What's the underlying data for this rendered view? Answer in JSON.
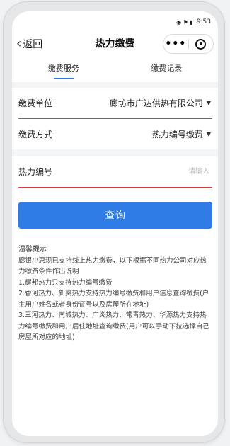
{
  "statusbar": {
    "icons": "◉ ⚑ ▮",
    "time": "9:53"
  },
  "navbar": {
    "back_label": "返回",
    "title": "热力缴费",
    "more_label": "•••"
  },
  "tabs": [
    {
      "label": "缴费服务",
      "active": true
    },
    {
      "label": "缴费记录",
      "active": false
    }
  ],
  "form": {
    "unit_label": "缴费单位",
    "unit_value": "廊坊市广达供热有限公司",
    "method_label": "缴费方式",
    "method_value": "热力编号缴费",
    "number_label": "热力编号",
    "number_placeholder": "请输入"
  },
  "query_button": "查询",
  "tips": {
    "title": "温馨提示",
    "lines": [
      "廊银小惠现已支持线上热力缴费，以下根据不同热力公司对应热力缴费条件作出说明",
      "1.耀邦热力只支持热力编号缴费",
      "2.香河热力、新奥热力支持热力编号缴费和用户信息查询缴费(户主用户姓名或者身份证号以及房屋所在地址)",
      "3.三河热力、南城热力、广炎热力、常青热力、华源热力支持热力编号缴费和用户居住地址查询缴费(用户可以手动下拉选择自己房屋所对应的地址)"
    ]
  },
  "colors": {
    "accent": "#2f7ce6",
    "divider_red": "#d73b3b"
  }
}
